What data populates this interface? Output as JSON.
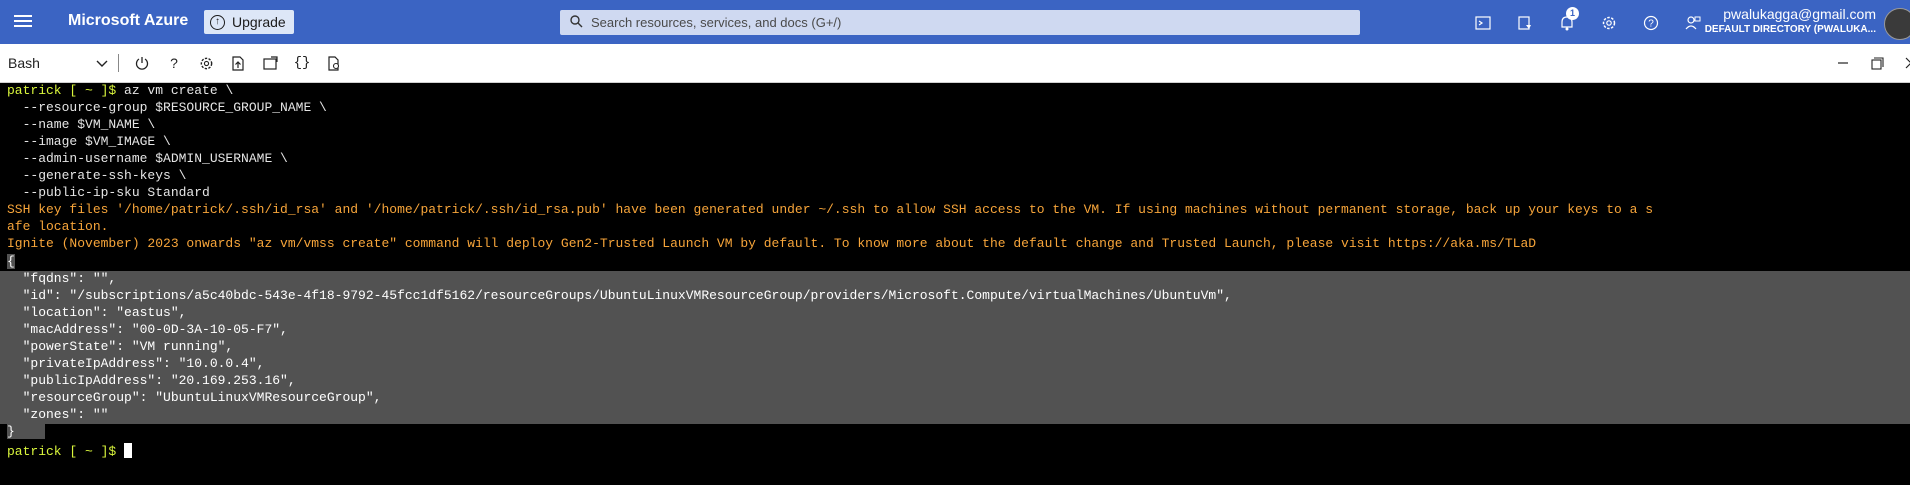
{
  "topbar": {
    "brand": "Microsoft Azure",
    "upgrade_label": "Upgrade",
    "search_placeholder": "Search resources, services, and docs (G+/)",
    "notification_count": "1",
    "user_email": "pwalukagga@gmail.com",
    "user_directory": "DEFAULT DIRECTORY (PWALUKA...",
    "colors": {
      "topbar_bg": "#3b64c3",
      "search_bg": "#cfd9f1"
    }
  },
  "toolbar": {
    "shell_type": "Bash",
    "icons": [
      "power-icon",
      "help-icon",
      "settings-icon",
      "upload-icon",
      "open-editor-icon",
      "braces-icon",
      "preview-icon"
    ]
  },
  "terminal": {
    "prompt": "patrick [ ~ ]$",
    "command_lines": [
      "az vm create \\",
      "  --resource-group $RESOURCE_GROUP_NAME \\",
      "  --name $VM_NAME \\",
      "  --image $VM_IMAGE \\",
      "  --admin-username $ADMIN_USERNAME \\",
      "  --generate-ssh-keys \\",
      "  --public-ip-sku Standard"
    ],
    "warning_lines": [
      "SSH key files '/home/patrick/.ssh/id_rsa' and '/home/patrick/.ssh/id_rsa.pub' have been generated under ~/.ssh to allow SSH access to the VM. If using machines without permanent storage, back up your keys to a s",
      "afe location.",
      "Ignite (November) 2023 onwards \"az vm/vmss create\" command will deploy Gen2-Trusted Launch VM by default. To know more about the default change and Trusted Launch, please visit https://aka.ms/TLaD"
    ],
    "output_lines": [
      "{",
      "  \"fqdns\": \"\",",
      "  \"id\": \"/subscriptions/a5c40bdc-543e-4f18-9792-45fcc1df5162/resourceGroups/UbuntuLinuxVMResourceGroup/providers/Microsoft.Compute/virtualMachines/UbuntuVm\",",
      "  \"location\": \"eastus\",",
      "  \"macAddress\": \"00-0D-3A-10-05-F7\",",
      "  \"powerState\": \"VM running\",",
      "  \"privateIpAddress\": \"10.0.0.4\",",
      "  \"publicIpAddress\": \"20.169.253.16\",",
      "  \"resourceGroup\": \"UbuntuLinuxVMResourceGroup\",",
      "  \"zones\": \"\"",
      "}"
    ],
    "colors": {
      "prompt": "#d9f53c",
      "warning": "#f7a53a",
      "selection": "#525252"
    }
  }
}
